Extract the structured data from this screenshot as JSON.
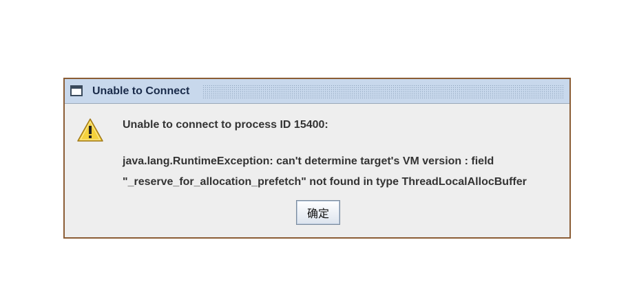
{
  "dialog": {
    "title": "Unable to Connect",
    "icons": {
      "window": "window-icon",
      "message": "warning-icon"
    },
    "message": {
      "line1": "Unable to connect to process ID 15400:",
      "line2": "java.lang.RuntimeException: can't determine target's VM version : field",
      "line3": "\"_reserve_for_allocation_prefetch\" not found in type ThreadLocalAllocBuffer"
    },
    "ok_label": "确定"
  },
  "colors": {
    "border": "#8a5c34",
    "titlebar": "#c8d8ec",
    "title_text": "#1a2b4a",
    "body_bg": "#eeeeee",
    "warning_fill": "#f5d23c"
  }
}
